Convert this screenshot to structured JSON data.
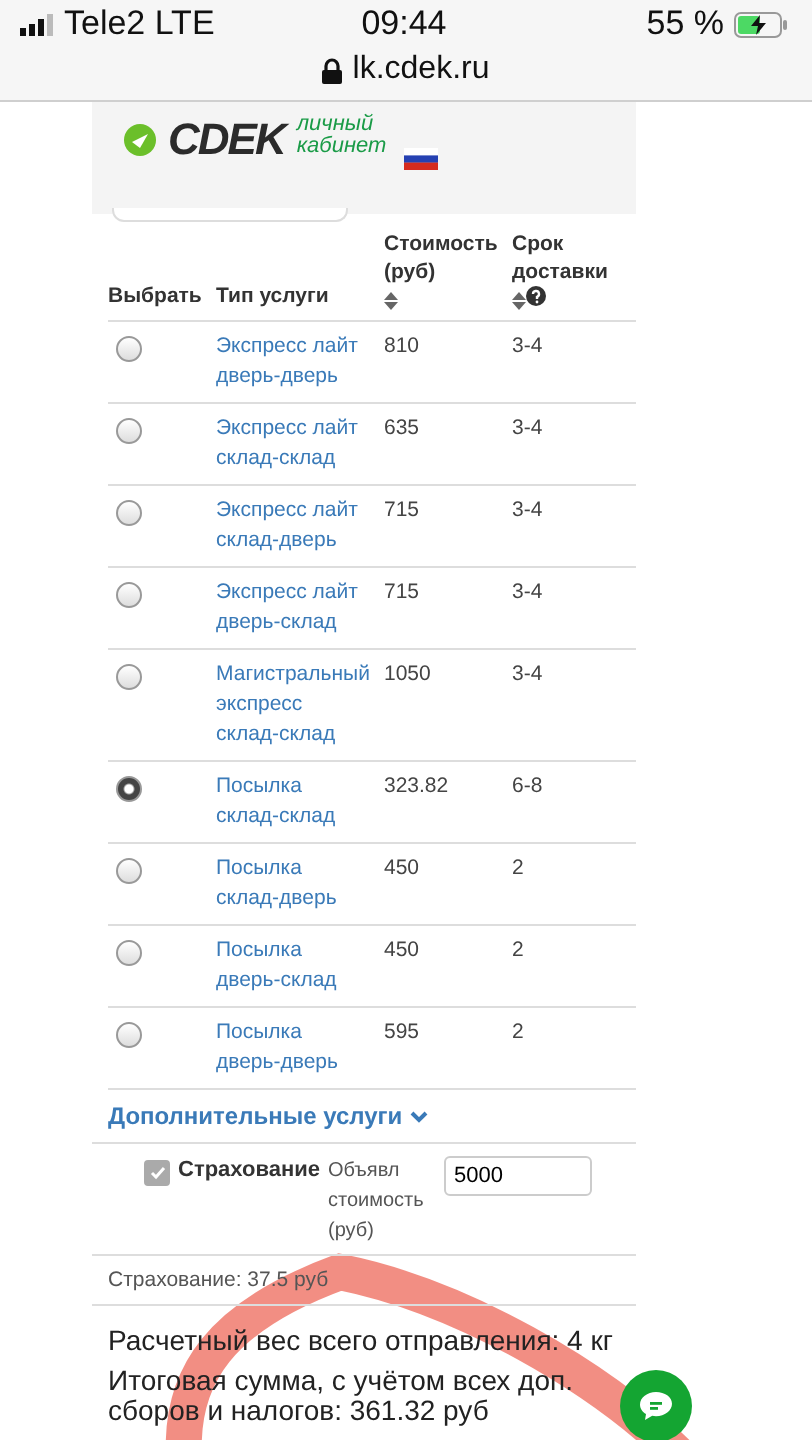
{
  "status_bar": {
    "carrier": "Tele2 LTE",
    "time": "09:44",
    "battery": "55 %"
  },
  "address_bar": {
    "url": "lk.cdek.ru"
  },
  "header": {
    "logo": "CDEK",
    "tagline": "личный кабинет"
  },
  "table": {
    "columns": [
      {
        "label": "Выбрать",
        "sortable": false,
        "help": false
      },
      {
        "label": "Тип услуги",
        "sortable": false,
        "help": false
      },
      {
        "label": "Стоимость (руб)",
        "sortable": true,
        "help": false
      },
      {
        "label": "Срок доставки",
        "sortable": true,
        "help": true
      }
    ],
    "rows": [
      {
        "service": "Экспресс лайт дверь-дверь",
        "price": "810",
        "days": "3-4",
        "selected": false
      },
      {
        "service": "Экспресс лайт склад-склад",
        "price": "635",
        "days": "3-4",
        "selected": false
      },
      {
        "service": "Экспресс лайт склад-дверь",
        "price": "715",
        "days": "3-4",
        "selected": false
      },
      {
        "service": "Экспресс лайт дверь-склад",
        "price": "715",
        "days": "3-4",
        "selected": false
      },
      {
        "service": "Магистральный экспресс склад-склад",
        "price": "1050",
        "days": "3-4",
        "selected": false
      },
      {
        "service": "Посылка склад-склад",
        "price": "323.82",
        "days": "6-8",
        "selected": true
      },
      {
        "service": "Посылка склад-дверь",
        "price": "450",
        "days": "2",
        "selected": false
      },
      {
        "service": "Посылка дверь-склад",
        "price": "450",
        "days": "2",
        "selected": false
      },
      {
        "service": "Посылка дверь-дверь",
        "price": "595",
        "days": "2",
        "selected": false
      }
    ]
  },
  "extras": {
    "title": "Дополнительные услуги",
    "expanded": true,
    "options": [
      {
        "label": "Страхование",
        "checked": true,
        "field_label": "Объявл стоимость (руб)",
        "value": "5000"
      }
    ],
    "insurance_cost": "Страхование: 37.5 руб"
  },
  "summary": [
    "Расчетный вес всего отправления: 4 кг",
    "Итоговая сумма, с учётом всех доп. сборов и налогов: 361.32 руб"
  ]
}
